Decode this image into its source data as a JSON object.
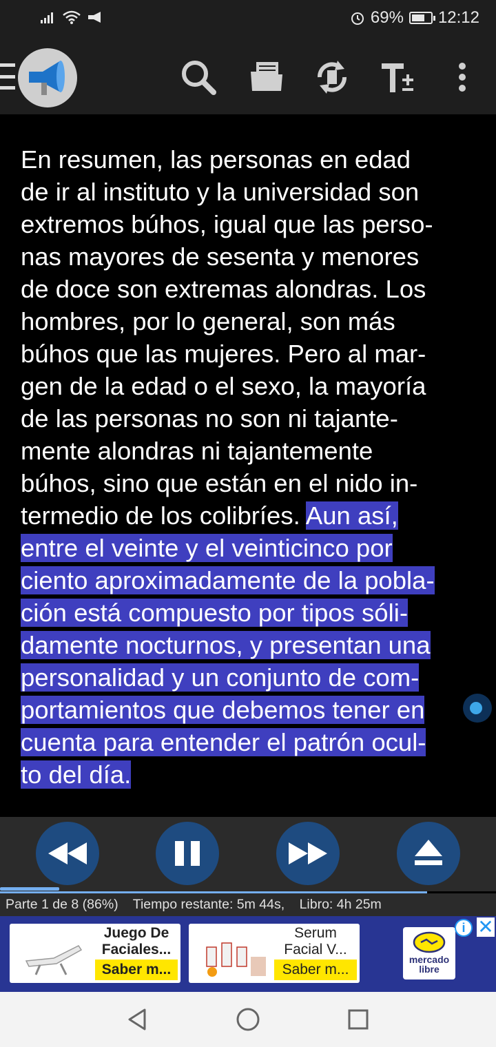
{
  "status_bar": {
    "battery_percent": "69%",
    "time": "12:12",
    "battery_level": 0.69
  },
  "toolbar": {
    "app_logo_icon": "megaphone-icon",
    "icons": [
      "menu-icon",
      "search-icon",
      "folder-icon",
      "sync-icon",
      "text-size-icon",
      "more-vertical-icon"
    ]
  },
  "reader": {
    "lines": [
      "En resumen, las personas en edad",
      "de ir al instituto y la universidad son",
      "extremos búhos, igual que las perso-",
      "nas mayores de sesenta y menores",
      "de doce son extremas alondras. Los",
      "hombres, por lo general, son más",
      "búhos que las mujeres. Pero al mar-",
      "gen de la edad o el sexo, la mayoría",
      "de las personas no son ni tajante-",
      "mente alondras ni tajantemente",
      "búhos, sino que están en el nido in-",
      "termedio de los colibríes. "
    ],
    "highlighted_start": "Aun así,",
    "highlighted_lines": [
      "entre el veinte y el veinticinco por",
      "ciento aproximadamente de la pobla-",
      "ción está compuesto por tipos sóli-",
      "damente nocturnos, y presentan una",
      "personalidad y un conjunto de com-",
      "portamientos que debemos tener en",
      "cuenta para entender el patrón ocul-",
      "to del día."
    ],
    "highlight_color": "#3f3fbf"
  },
  "player": {
    "buttons": [
      "rewind-icon",
      "pause-icon",
      "fast-forward-icon",
      "eject-icon"
    ],
    "button_color": "#1e4b80",
    "progress_fraction": 0.12,
    "info": {
      "part": "Parte 1 de 8 (86%)",
      "remaining": "Tiempo restante: 5m 44s,",
      "book": "Libro: 4h 25m"
    }
  },
  "ad": {
    "card1": {
      "title": "Juego De Faciales...",
      "cta": "Saber m..."
    },
    "card2": {
      "title_line1": "Serum",
      "title_line2": "Facial V...",
      "cta": "Saber m..."
    },
    "logo_text_1": "mercado",
    "logo_text_2": "libre",
    "info_label": "i",
    "close_label": "✕"
  },
  "navbar": {
    "icons": [
      "back-icon",
      "home-icon",
      "recents-icon"
    ]
  }
}
